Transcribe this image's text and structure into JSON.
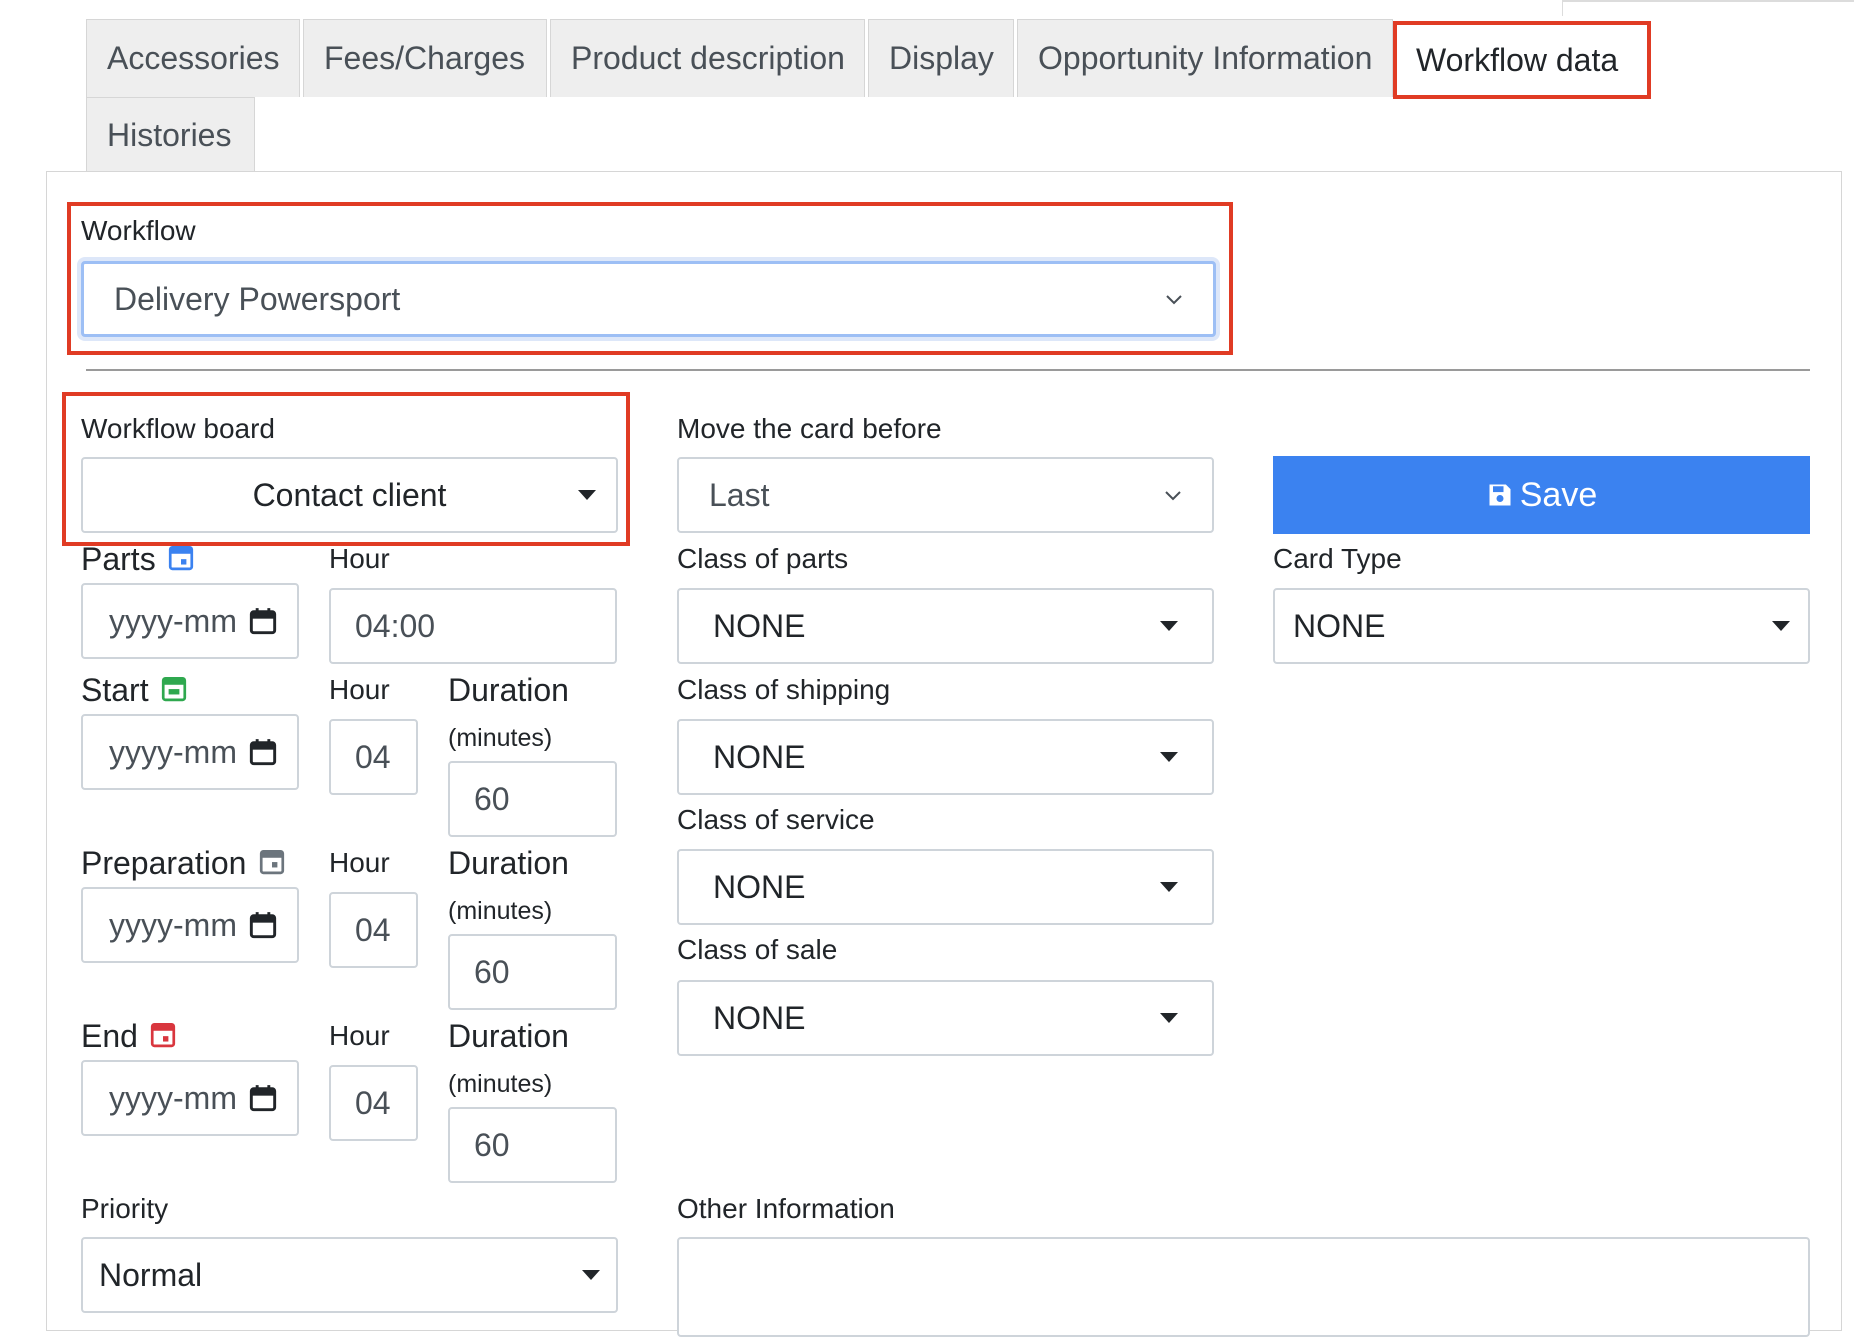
{
  "tabs": {
    "accessories": "Accessories",
    "fees": "Fees/Charges",
    "product_description": "Product description",
    "display": "Display",
    "opportunity": "Opportunity Information",
    "workflow_data": "Workflow data",
    "histories": "Histories"
  },
  "workflow": {
    "label": "Workflow",
    "value": "Delivery Powersport"
  },
  "workflow_board": {
    "label": "Workflow board",
    "value": "Contact client"
  },
  "move_card": {
    "label": "Move the card before",
    "value": "Last"
  },
  "save_label": "Save",
  "parts": {
    "label": "Parts",
    "date_placeholder": "yyyy-mm",
    "hour_label": "Hour",
    "hour_value": "04:00"
  },
  "start": {
    "label": "Start",
    "date_placeholder": "yyyy-mm",
    "hour_label": "Hour",
    "hour_value": "04",
    "duration_label": "Duration",
    "duration_unit": "(minutes)",
    "duration_value": "60"
  },
  "preparation": {
    "label": "Preparation",
    "date_placeholder": "yyyy-mm",
    "hour_label": "Hour",
    "hour_value": "04",
    "duration_label": "Duration",
    "duration_unit": "(minutes)",
    "duration_value": "60"
  },
  "end": {
    "label": "End",
    "date_placeholder": "yyyy-mm",
    "hour_label": "Hour",
    "hour_value": "04",
    "duration_label": "Duration",
    "duration_unit": "(minutes)",
    "duration_value": "60"
  },
  "class_of_parts": {
    "label": "Class of parts",
    "value": "NONE"
  },
  "class_of_shipping": {
    "label": "Class of shipping",
    "value": "NONE"
  },
  "class_of_service": {
    "label": "Class of service",
    "value": "NONE"
  },
  "class_of_sale": {
    "label": "Class of sale",
    "value": "NONE"
  },
  "card_type": {
    "label": "Card Type",
    "value": "NONE"
  },
  "priority": {
    "label": "Priority",
    "value": "Normal"
  },
  "other_information": {
    "label": "Other Information",
    "value": ""
  },
  "colors": {
    "highlight": "#e03b24",
    "primary": "#3b82f0",
    "parts_icon": "#3b82f0",
    "start_icon": "#2fa84f",
    "preparation_icon": "#6c757d",
    "end_icon": "#d9363e"
  }
}
